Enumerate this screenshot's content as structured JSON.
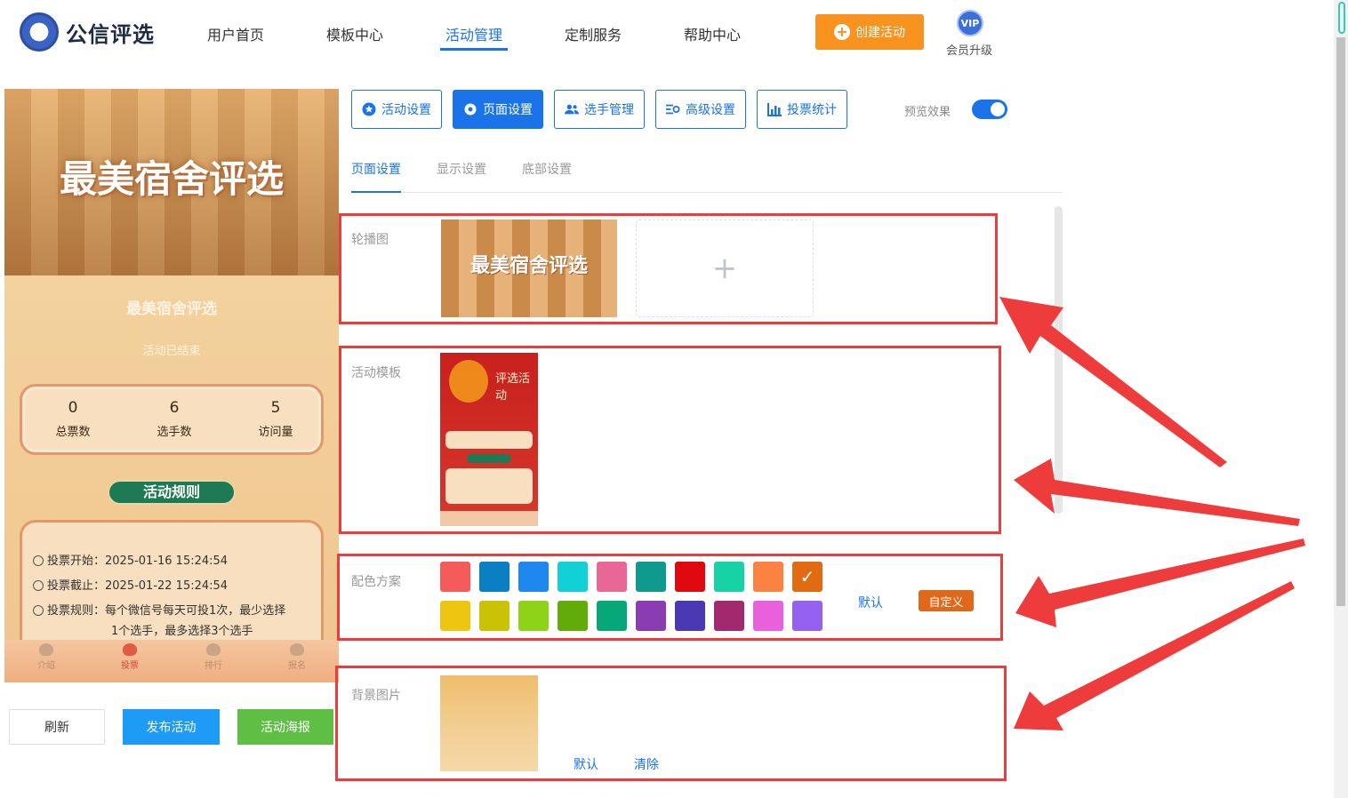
{
  "header": {
    "logo_text": "公信评选",
    "nav": [
      {
        "label": "用户首页"
      },
      {
        "label": "模板中心"
      },
      {
        "label": "活动管理"
      },
      {
        "label": "定制服务"
      },
      {
        "label": "帮助中心"
      }
    ],
    "create_button": "创建活动",
    "vip_badge": "VIP",
    "vip_label": "会员升级"
  },
  "preview": {
    "banner_title": "最美宿舍评选",
    "title": "最美宿舍评选",
    "status": "活动已结束",
    "stats": [
      {
        "value": "0",
        "label": "总票数"
      },
      {
        "value": "6",
        "label": "选手数"
      },
      {
        "value": "5",
        "label": "访问量"
      }
    ],
    "rules_button": "活动规则",
    "rules": {
      "start": "投票开始：2025-01-16 15:24:54",
      "end": "投票截止：2025-01-22 15:24:54",
      "rule_line1": "投票规则：每个微信号每天可投1次，最少选择",
      "rule_line2": "1个选手，最多选择3个选手"
    },
    "tabs": [
      {
        "label": "介绍"
      },
      {
        "label": "投票"
      },
      {
        "label": "排行"
      },
      {
        "label": "报名"
      }
    ]
  },
  "actions": {
    "refresh": "刷新",
    "publish": "发布活动",
    "poster": "活动海报"
  },
  "toolbar": {
    "buttons": [
      {
        "label": "活动设置"
      },
      {
        "label": "页面设置"
      },
      {
        "label": "选手管理"
      },
      {
        "label": "高级设置"
      },
      {
        "label": "投票统计"
      }
    ],
    "preview_label": "预览效果",
    "preview_on": true
  },
  "subtabs": [
    {
      "label": "页面设置"
    },
    {
      "label": "显示设置"
    },
    {
      "label": "底部设置"
    }
  ],
  "sections": {
    "carousel": {
      "label": "轮播图",
      "image_title": "最美宿舍评选",
      "upload_icon": "+"
    },
    "template": {
      "label": "活动模板",
      "thumb_title": "评选活动"
    },
    "colors": {
      "label": "配色方案",
      "row1": [
        "#f55b5b",
        "#0a7fc4",
        "#1e88f0",
        "#12d1d6",
        "#e96796",
        "#0f9a8e",
        "#e0090f",
        "#17d2a4",
        "#fb8241",
        "#e06b12"
      ],
      "row2": [
        "#eec612",
        "#cac204",
        "#8ed317",
        "#62ac09",
        "#06a87a",
        "#8a3cb3",
        "#4b38b3",
        "#a2296b",
        "#e960dd",
        "#9461f0"
      ],
      "selected_index": 9,
      "default_link": "默认",
      "custom_button": "自定义"
    },
    "background": {
      "label": "背景图片",
      "default_link": "默认",
      "clear_link": "清除"
    }
  },
  "colors": {
    "accent": "#1a73e8",
    "highlight_red": "#ef3b3b",
    "orange": "#f7931e"
  }
}
